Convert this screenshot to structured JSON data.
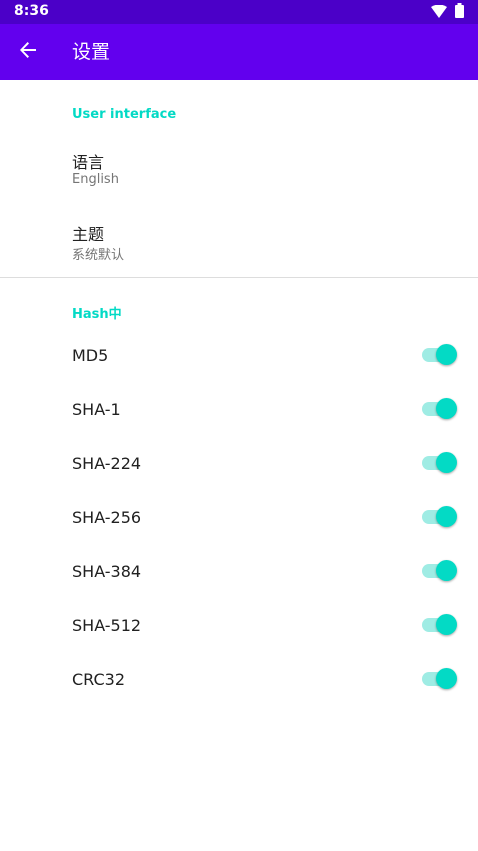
{
  "status_bar": {
    "time": "8:36",
    "icons": [
      "wifi-icon",
      "battery-icon"
    ]
  },
  "app_bar": {
    "title": "设置",
    "back_icon": "arrow-back-icon"
  },
  "sections": {
    "ui": {
      "header": "User interface",
      "language_title": "语言",
      "language_value": "English",
      "theme_title": "主题",
      "theme_value": "系统默认"
    },
    "hash": {
      "header": "Hash中",
      "items": [
        {
          "label": "MD5",
          "enabled": true
        },
        {
          "label": "SHA-1",
          "enabled": true
        },
        {
          "label": "SHA-224",
          "enabled": true
        },
        {
          "label": "SHA-256",
          "enabled": true
        },
        {
          "label": "SHA-384",
          "enabled": true
        },
        {
          "label": "SHA-512",
          "enabled": true
        },
        {
          "label": "CRC32",
          "enabled": true
        }
      ]
    }
  },
  "colors": {
    "status_bar": "#4b00c8",
    "app_bar": "#6200ee",
    "accent": "#03dac5",
    "switch_track": "#9fece4"
  }
}
